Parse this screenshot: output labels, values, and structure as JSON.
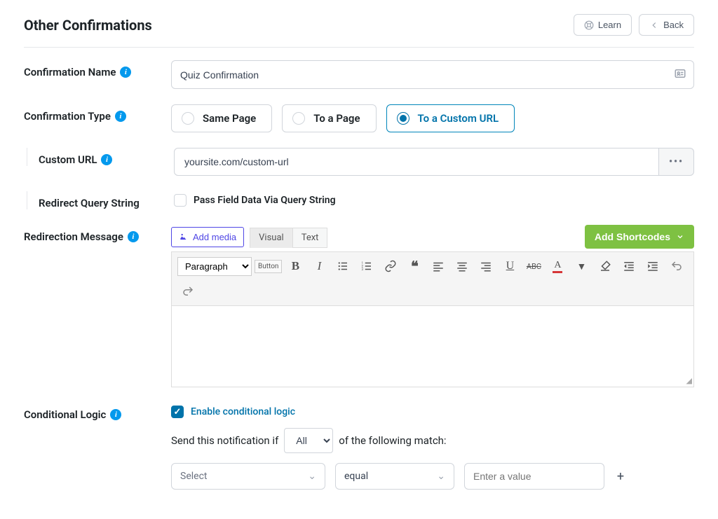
{
  "header": {
    "title": "Other Confirmations",
    "learn_label": "Learn",
    "back_label": "Back"
  },
  "labels": {
    "confirmation_name": "Confirmation Name",
    "confirmation_type": "Confirmation Type",
    "custom_url": "Custom URL",
    "redirect_query_string": "Redirect Query String",
    "redirection_message": "Redirection Message",
    "conditional_logic": "Conditional Logic"
  },
  "name": {
    "value": "Quiz Confirmation"
  },
  "type": {
    "options": [
      "Same Page",
      "To a Page",
      "To a Custom URL"
    ],
    "selected": 2
  },
  "url": {
    "value": "yoursite.com/custom-url",
    "more": "•••"
  },
  "query": {
    "label": "Pass Field Data Via Query String",
    "checked": false
  },
  "editor": {
    "add_media": "Add media",
    "tab_visual": "Visual",
    "tab_text": "Text",
    "shortcodes": "Add Shortcodes",
    "format_select": "Paragraph",
    "button_label": "Button"
  },
  "conditional": {
    "enable_label": "Enable conditional logic",
    "enabled": true,
    "sentence_pre": "Send this notification if",
    "match_scope": "All",
    "sentence_post": "of the following match:",
    "field_placeholder": "Select",
    "operator": "equal",
    "value_placeholder": "Enter a value"
  }
}
